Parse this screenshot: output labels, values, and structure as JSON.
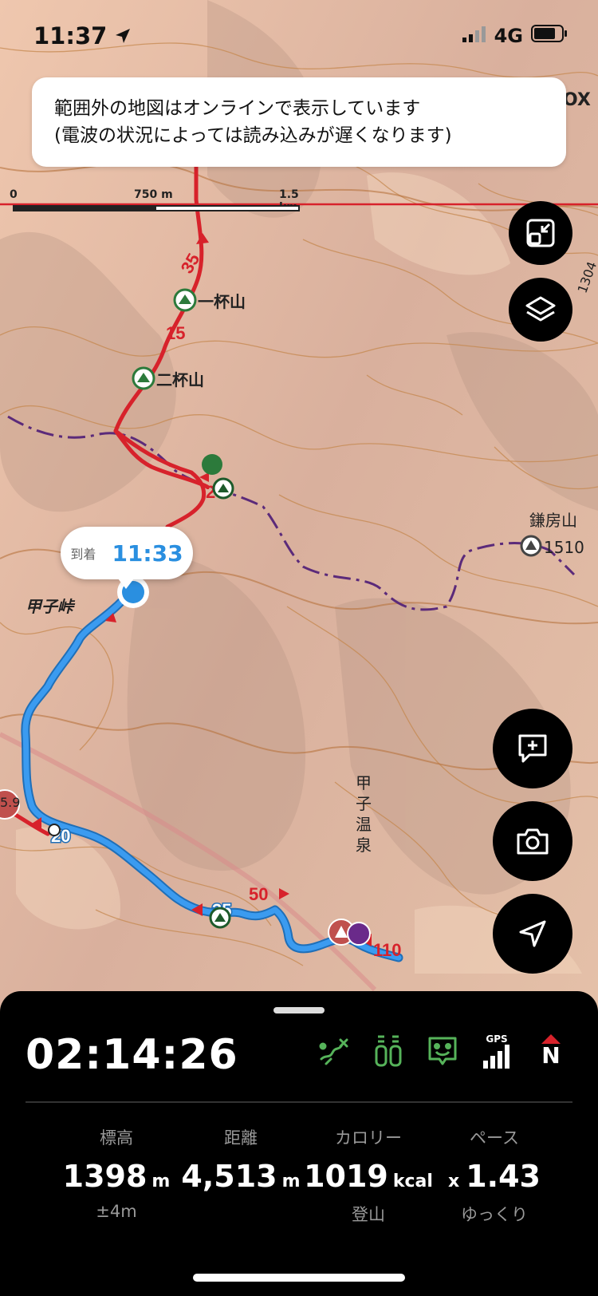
{
  "status_bar": {
    "time": "11:37",
    "network": "4G"
  },
  "notice": {
    "line1": "範囲外の地図はオンラインで表示しています",
    "line2": "(電波の状況によっては読み込みが遅くなります)"
  },
  "scale": {
    "start": "0",
    "mid": "750 m",
    "end": "1.5 km"
  },
  "map": {
    "labels": {
      "peak_1": "一杯山",
      "peak_2": "二杯山",
      "pass": "甲子峠",
      "mountain": "鎌房山",
      "mountain_elev": "1510",
      "onsen": "甲子温泉",
      "elev_partial": "5.9",
      "edge_partial_top": "OX",
      "edge_partial_right": "1304"
    },
    "route_markers": [
      "35",
      "15",
      "25",
      "20",
      "35",
      "50",
      "110"
    ],
    "arrival": {
      "label": "到着",
      "time": "11:33"
    }
  },
  "buttons": {
    "collapse": "collapse-map-icon",
    "layers": "layers-icon",
    "memo": "add-memo-icon",
    "camera": "camera-icon",
    "locate": "location-arrow-icon"
  },
  "panel": {
    "elapsed": "02:14:26",
    "status_icons": [
      "route-icon",
      "water-bottles-icon",
      "face-icon",
      "gps-signal-icon",
      "north-compass-icon"
    ],
    "gps_label": "GPS",
    "compass_label": "N",
    "stats": {
      "altitude": {
        "label": "標高",
        "value": "1398",
        "unit": "m",
        "sub": "±4m"
      },
      "distance": {
        "label": "距離",
        "value": "4,513",
        "unit": "m",
        "sub": ""
      },
      "calories": {
        "label": "カロリー",
        "value": "1019",
        "unit": "kcal",
        "sub": "登山"
      },
      "pace": {
        "label": "ペース",
        "prefix": "x",
        "value": "1.43",
        "sub": "ゆっくり"
      }
    }
  },
  "colors": {
    "route_planned": "#d7222b",
    "route_walked": "#2f8fe8",
    "boundary": "#5b2a7a",
    "accent": "#2a8fe0"
  }
}
